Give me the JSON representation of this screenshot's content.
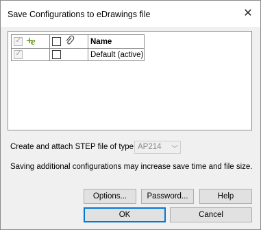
{
  "window": {
    "title": "Save Configurations to eDrawings file"
  },
  "table": {
    "name_header": "Name",
    "rows": [
      {
        "name": "Default (active)",
        "col1_checked": true,
        "col1_disabled": true,
        "col2_checked": false
      }
    ]
  },
  "step": {
    "label": "Create and attach STEP file of type:",
    "selected": "AP214"
  },
  "info_text": "Saving additional configurations may increase save time and file size.",
  "buttons": {
    "options": "Options...",
    "password": "Password...",
    "help": "Help",
    "ok": "OK",
    "cancel": "Cancel"
  },
  "colors": {
    "accent": "#0078d7",
    "edrawings_icon": "#6a9a1f"
  }
}
